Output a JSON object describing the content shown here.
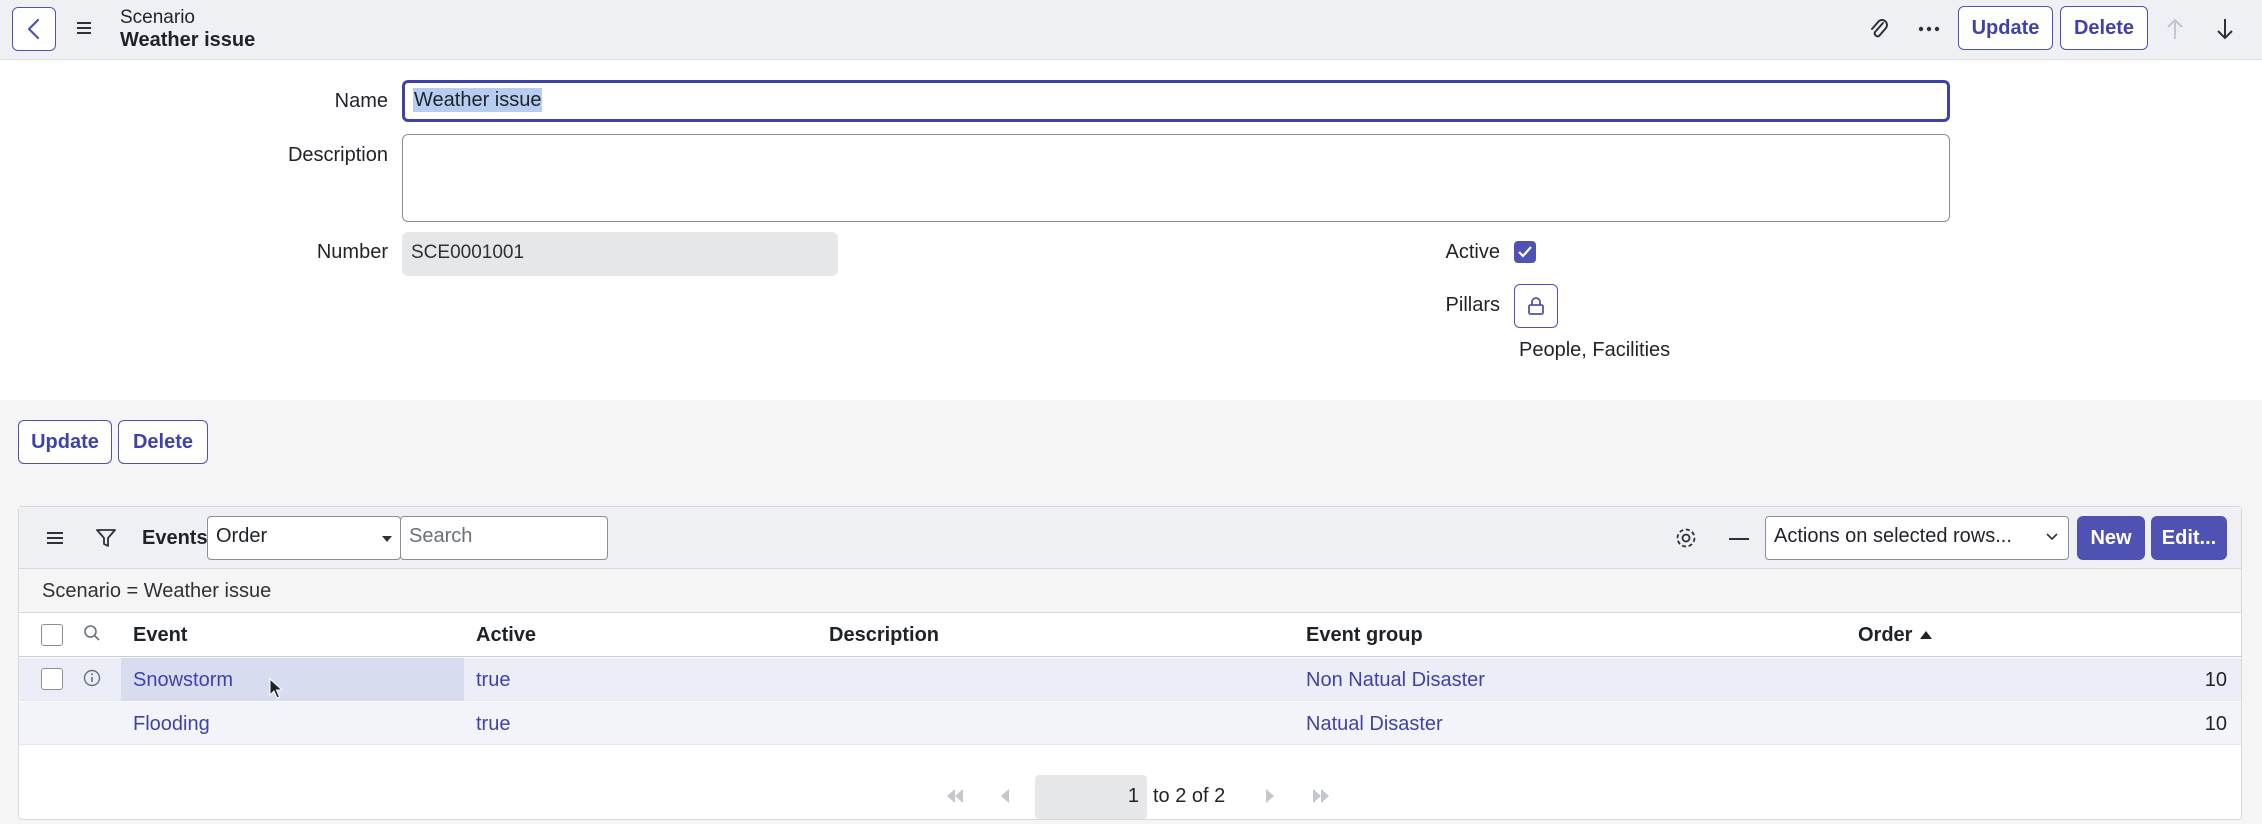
{
  "header": {
    "title_line1": "Scenario",
    "title_line2": "Weather issue",
    "update_label": "Update",
    "delete_label": "Delete"
  },
  "form": {
    "name_label": "Name",
    "name_value": "Weather issue",
    "description_label": "Description",
    "description_value": "",
    "number_label": "Number",
    "number_value": "SCE0001001",
    "active_label": "Active",
    "active_checked": true,
    "pillars_label": "Pillars",
    "pillars_value": "People, Facilities"
  },
  "form_actions": {
    "update_label": "Update",
    "delete_label": "Delete"
  },
  "related_list": {
    "title": "Events",
    "sort_field": "Order",
    "search_placeholder": "Search",
    "actions_label": "Actions on selected rows...",
    "new_label": "New",
    "edit_label": "Edit...",
    "breadcrumb": "Scenario = Weather issue",
    "columns": [
      "Event",
      "Active",
      "Description",
      "Event group",
      "Order"
    ],
    "rows": [
      {
        "event": "Snowstorm",
        "active": "true",
        "description": "",
        "event_group": "Non Natual Disaster",
        "order": "10"
      },
      {
        "event": "Flooding",
        "active": "true",
        "description": "",
        "event_group": "Natual Disaster",
        "order": "10"
      }
    ],
    "pager": {
      "page": "1",
      "range_text": "to 2 of 2"
    }
  },
  "colors": {
    "accent": "#4f52b2",
    "link": "#3f43a8",
    "header_bg": "#eef0f3"
  }
}
